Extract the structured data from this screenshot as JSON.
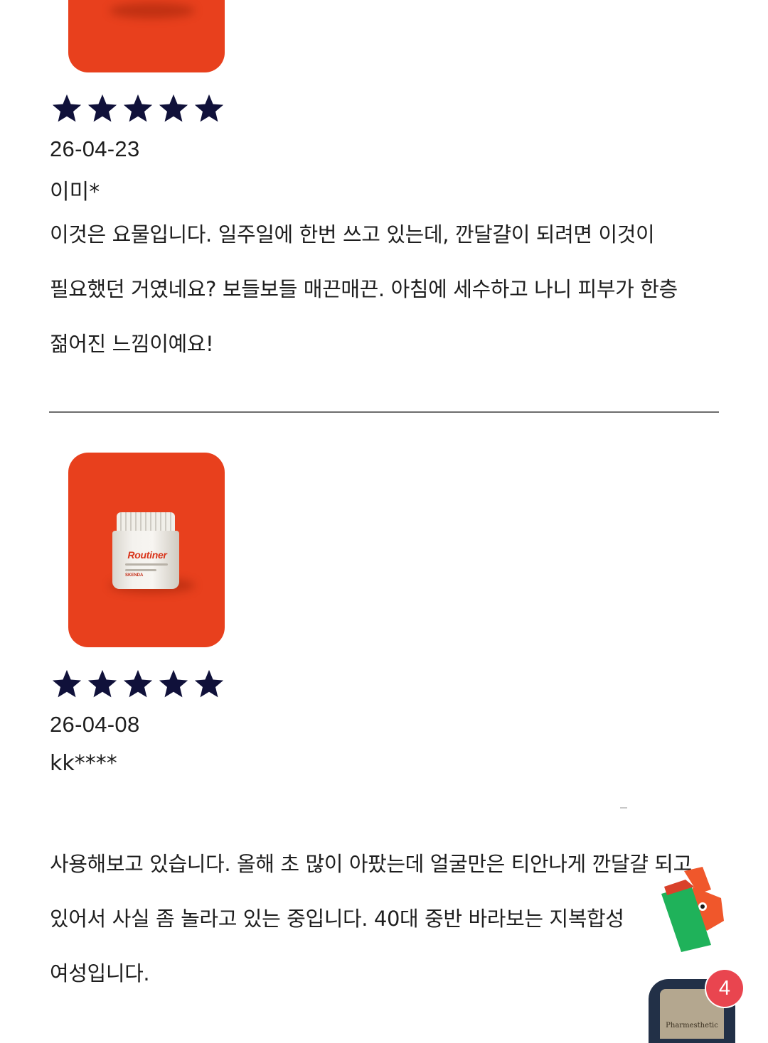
{
  "colors": {
    "star": "#10113a",
    "product_bg": "#e8401d",
    "badge": "#e9454f",
    "divider": "#6d6d6d"
  },
  "reviews": [
    {
      "rating": 5,
      "date": "26-04-23",
      "author": "이미*",
      "lines": [
        "이것은 요물입니다. 일주일에 한번 쓰고 있는데, 깐달걀이 되려면 이것이",
        "필요했던 거였네요? 보들보들 매끈매끈. 아침에 세수하고 나니 피부가 한층",
        "젊어진 느낌이예요!"
      ]
    },
    {
      "rating": 5,
      "date": "26-04-08",
      "author": "kk****",
      "product": {
        "brand": "Routiner",
        "maker": "SKENDA"
      },
      "lines": [
        "사용해보고 있습니다. 올해 초 많이 아팠는데 얼굴만은 티안나게 깐달걀 되고",
        "있어서 사실 좀 놀라고 있는 중입니다. 40대 중반 바라보는 지복합성",
        "여성입니다."
      ]
    }
  ],
  "floating": {
    "book_title": "Pharmesthetic",
    "badge_count": "4"
  }
}
